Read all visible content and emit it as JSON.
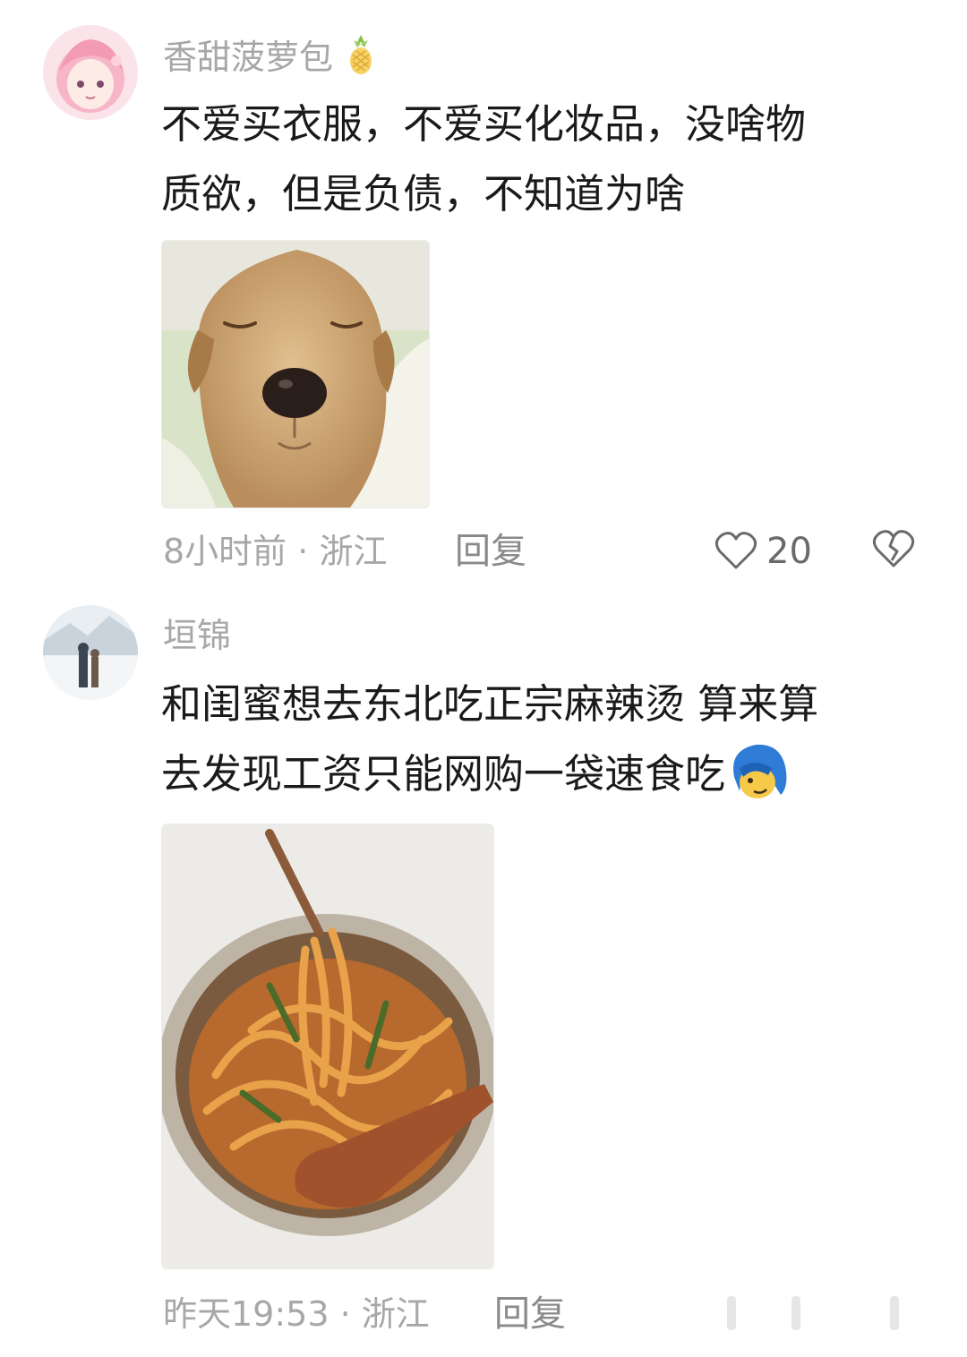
{
  "comments": [
    {
      "username": "香甜菠萝包",
      "username_badge": "pineapple-icon",
      "text_lines": [
        "不爱买衣服，不爱买化妆品，没啥物",
        "质欲，但是负债，不知道为啥"
      ],
      "image": "sleepy-puppy-photo",
      "time": "8小时前",
      "location": "浙江",
      "reply_label": "回复",
      "like_count": "20"
    },
    {
      "username": "垣锦",
      "text_lines": [
        "和闺蜜想去东北吃正宗麻辣烫 算来算",
        "去发现工资只能网购一袋速食吃"
      ],
      "text_emoji": "blue-hair-face-emoji",
      "image": "spicy-noodles-bowl-photo",
      "time": "昨天19:53",
      "location": "浙江",
      "reply_label": "回复"
    }
  ]
}
